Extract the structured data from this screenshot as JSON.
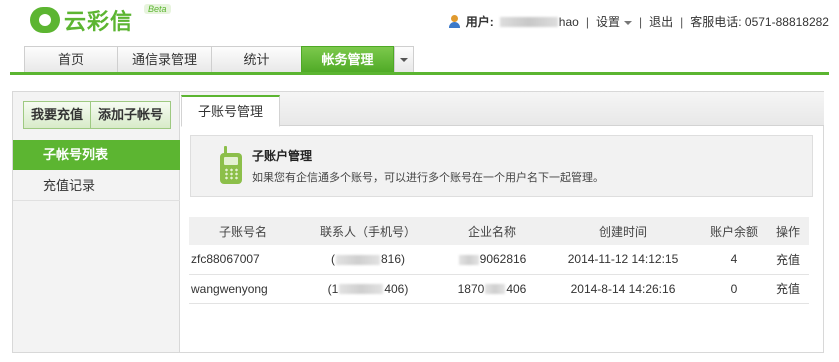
{
  "header": {
    "logo_text": "云彩信",
    "logo_badge": "Beta",
    "user_label": "用户:",
    "user_name_suffix": "hao",
    "settings_label": "设置",
    "logout_label": "退出",
    "hotline": "客服电话: 0571-88818282",
    "separator": "|"
  },
  "nav": {
    "tabs": [
      {
        "label": "首页"
      },
      {
        "label": "通信录管理"
      },
      {
        "label": "统计"
      },
      {
        "label": "帐务管理"
      }
    ],
    "active_index": 3
  },
  "sidebar": {
    "recharge_button": "我要充值",
    "add_account_button": "添加子帐号",
    "items": [
      {
        "label": "子帐号列表"
      },
      {
        "label": "充值记录"
      }
    ],
    "active_index": 0
  },
  "content": {
    "tab_label": "子账号管理",
    "info_title": "子账户管理",
    "info_desc": "如果您有企信通多个账号，可以进行多个账号在一个用户名下一起管理。"
  },
  "table": {
    "columns": [
      "子账号名",
      "联系人（手机号）",
      "企业名称",
      "创建时间",
      "账户余额",
      "操作"
    ],
    "rows": [
      {
        "account": "zfc88067007",
        "contact_prefix": "(",
        "contact_suffix": "816)",
        "company_suffix": "9062816",
        "created": "2014-11-12 14:12:15",
        "balance": "4",
        "action": "充值"
      },
      {
        "account": "wangwenyong",
        "contact_prefix": "(1",
        "contact_suffix": "406)",
        "company_prefix": "1870",
        "company_suffix": "406",
        "created": "2014-8-14 14:26:16",
        "balance": "0",
        "action": "充值"
      }
    ]
  },
  "colors": {
    "brand_green": "#5cb531",
    "sidebar_bg": "#f3f3f3"
  }
}
